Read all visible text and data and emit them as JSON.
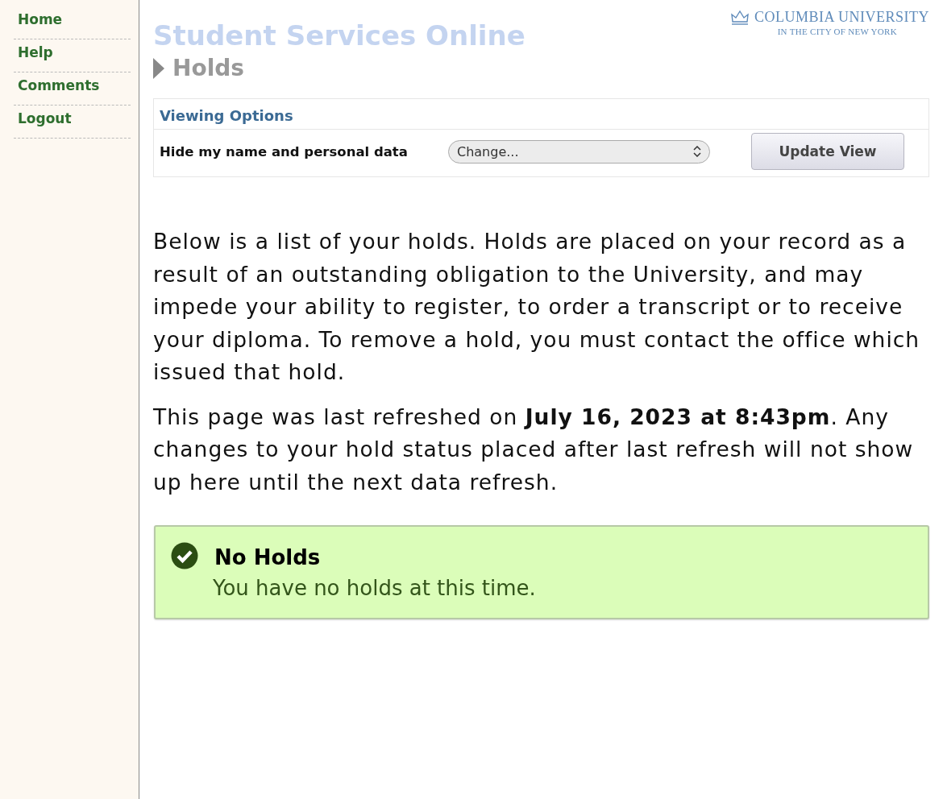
{
  "sidebar": {
    "items": [
      {
        "label": "Home"
      },
      {
        "label": "Help"
      },
      {
        "label": "Comments"
      },
      {
        "label": "Logout"
      }
    ]
  },
  "header": {
    "title": "Student Services Online",
    "section": "Holds",
    "logo": {
      "name": "COLUMBIA UNIVERSITY",
      "subtitle": "IN THE CITY OF NEW YORK"
    }
  },
  "viewing_options": {
    "heading": "Viewing Options",
    "label": "Hide my name and personal data",
    "select": {
      "value": "Change..."
    },
    "button": "Update View"
  },
  "paragraphs": [
    "Below is a list of your holds. Holds are placed on your record as a result of an outstanding obligation to the University, and may impede your ability to register, to order a transcript or to receive your diploma. To remove a hold, you must contact the office which issued that hold.",
    "This page was last refreshed on **July 16, 2023 at 8:43pm**. Any changes to your hold status placed after last refresh will not show up here until the next data refresh."
  ],
  "notice": {
    "title": "No Holds",
    "message": "You have no holds at this time."
  }
}
